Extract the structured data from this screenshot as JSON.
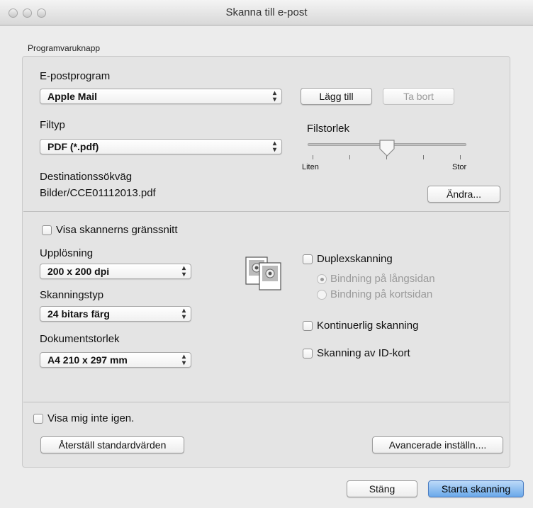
{
  "window": {
    "title": "Skanna till e-post"
  },
  "group_label": "Programvaruknapp",
  "email": {
    "label": "E-postprogram",
    "value": "Apple Mail",
    "add_button": "Lägg till",
    "remove_button": "Ta bort"
  },
  "filetype": {
    "label": "Filtyp",
    "value": "PDF (*.pdf)"
  },
  "filesize": {
    "label": "Filstorlek",
    "min_label": "Liten",
    "max_label": "Stor",
    "level": 0.5
  },
  "destination": {
    "label": "Destinationssökväg",
    "value": "Bilder/CCE01112013.pdf",
    "change_button": "Ändra..."
  },
  "show_scanner_interface": {
    "label": "Visa skannerns gränssnitt",
    "checked": false
  },
  "resolution": {
    "label": "Upplösning",
    "value": "200 x 200 dpi"
  },
  "scan_type": {
    "label": "Skanningstyp",
    "value": "24 bitars färg"
  },
  "document_size": {
    "label": "Dokumentstorlek",
    "value": "A4 210 x 297 mm"
  },
  "duplex": {
    "label": "Duplexskanning",
    "checked": false,
    "options": [
      "Bindning på långsidan",
      "Bindning på kortsidan"
    ],
    "selected": 0
  },
  "continuous": {
    "label": "Kontinuerlig skanning",
    "checked": false
  },
  "id_card": {
    "label": "Skanning av ID-kort",
    "checked": false
  },
  "dont_show_again": {
    "label": "Visa mig inte igen.",
    "checked": false
  },
  "buttons": {
    "restore_defaults": "Återställ standardvärden",
    "advanced": "Avancerade inställn....",
    "close": "Stäng",
    "start": "Starta skanning"
  },
  "colors": {
    "accent": "#6aa9ea",
    "background": "#ececec"
  }
}
